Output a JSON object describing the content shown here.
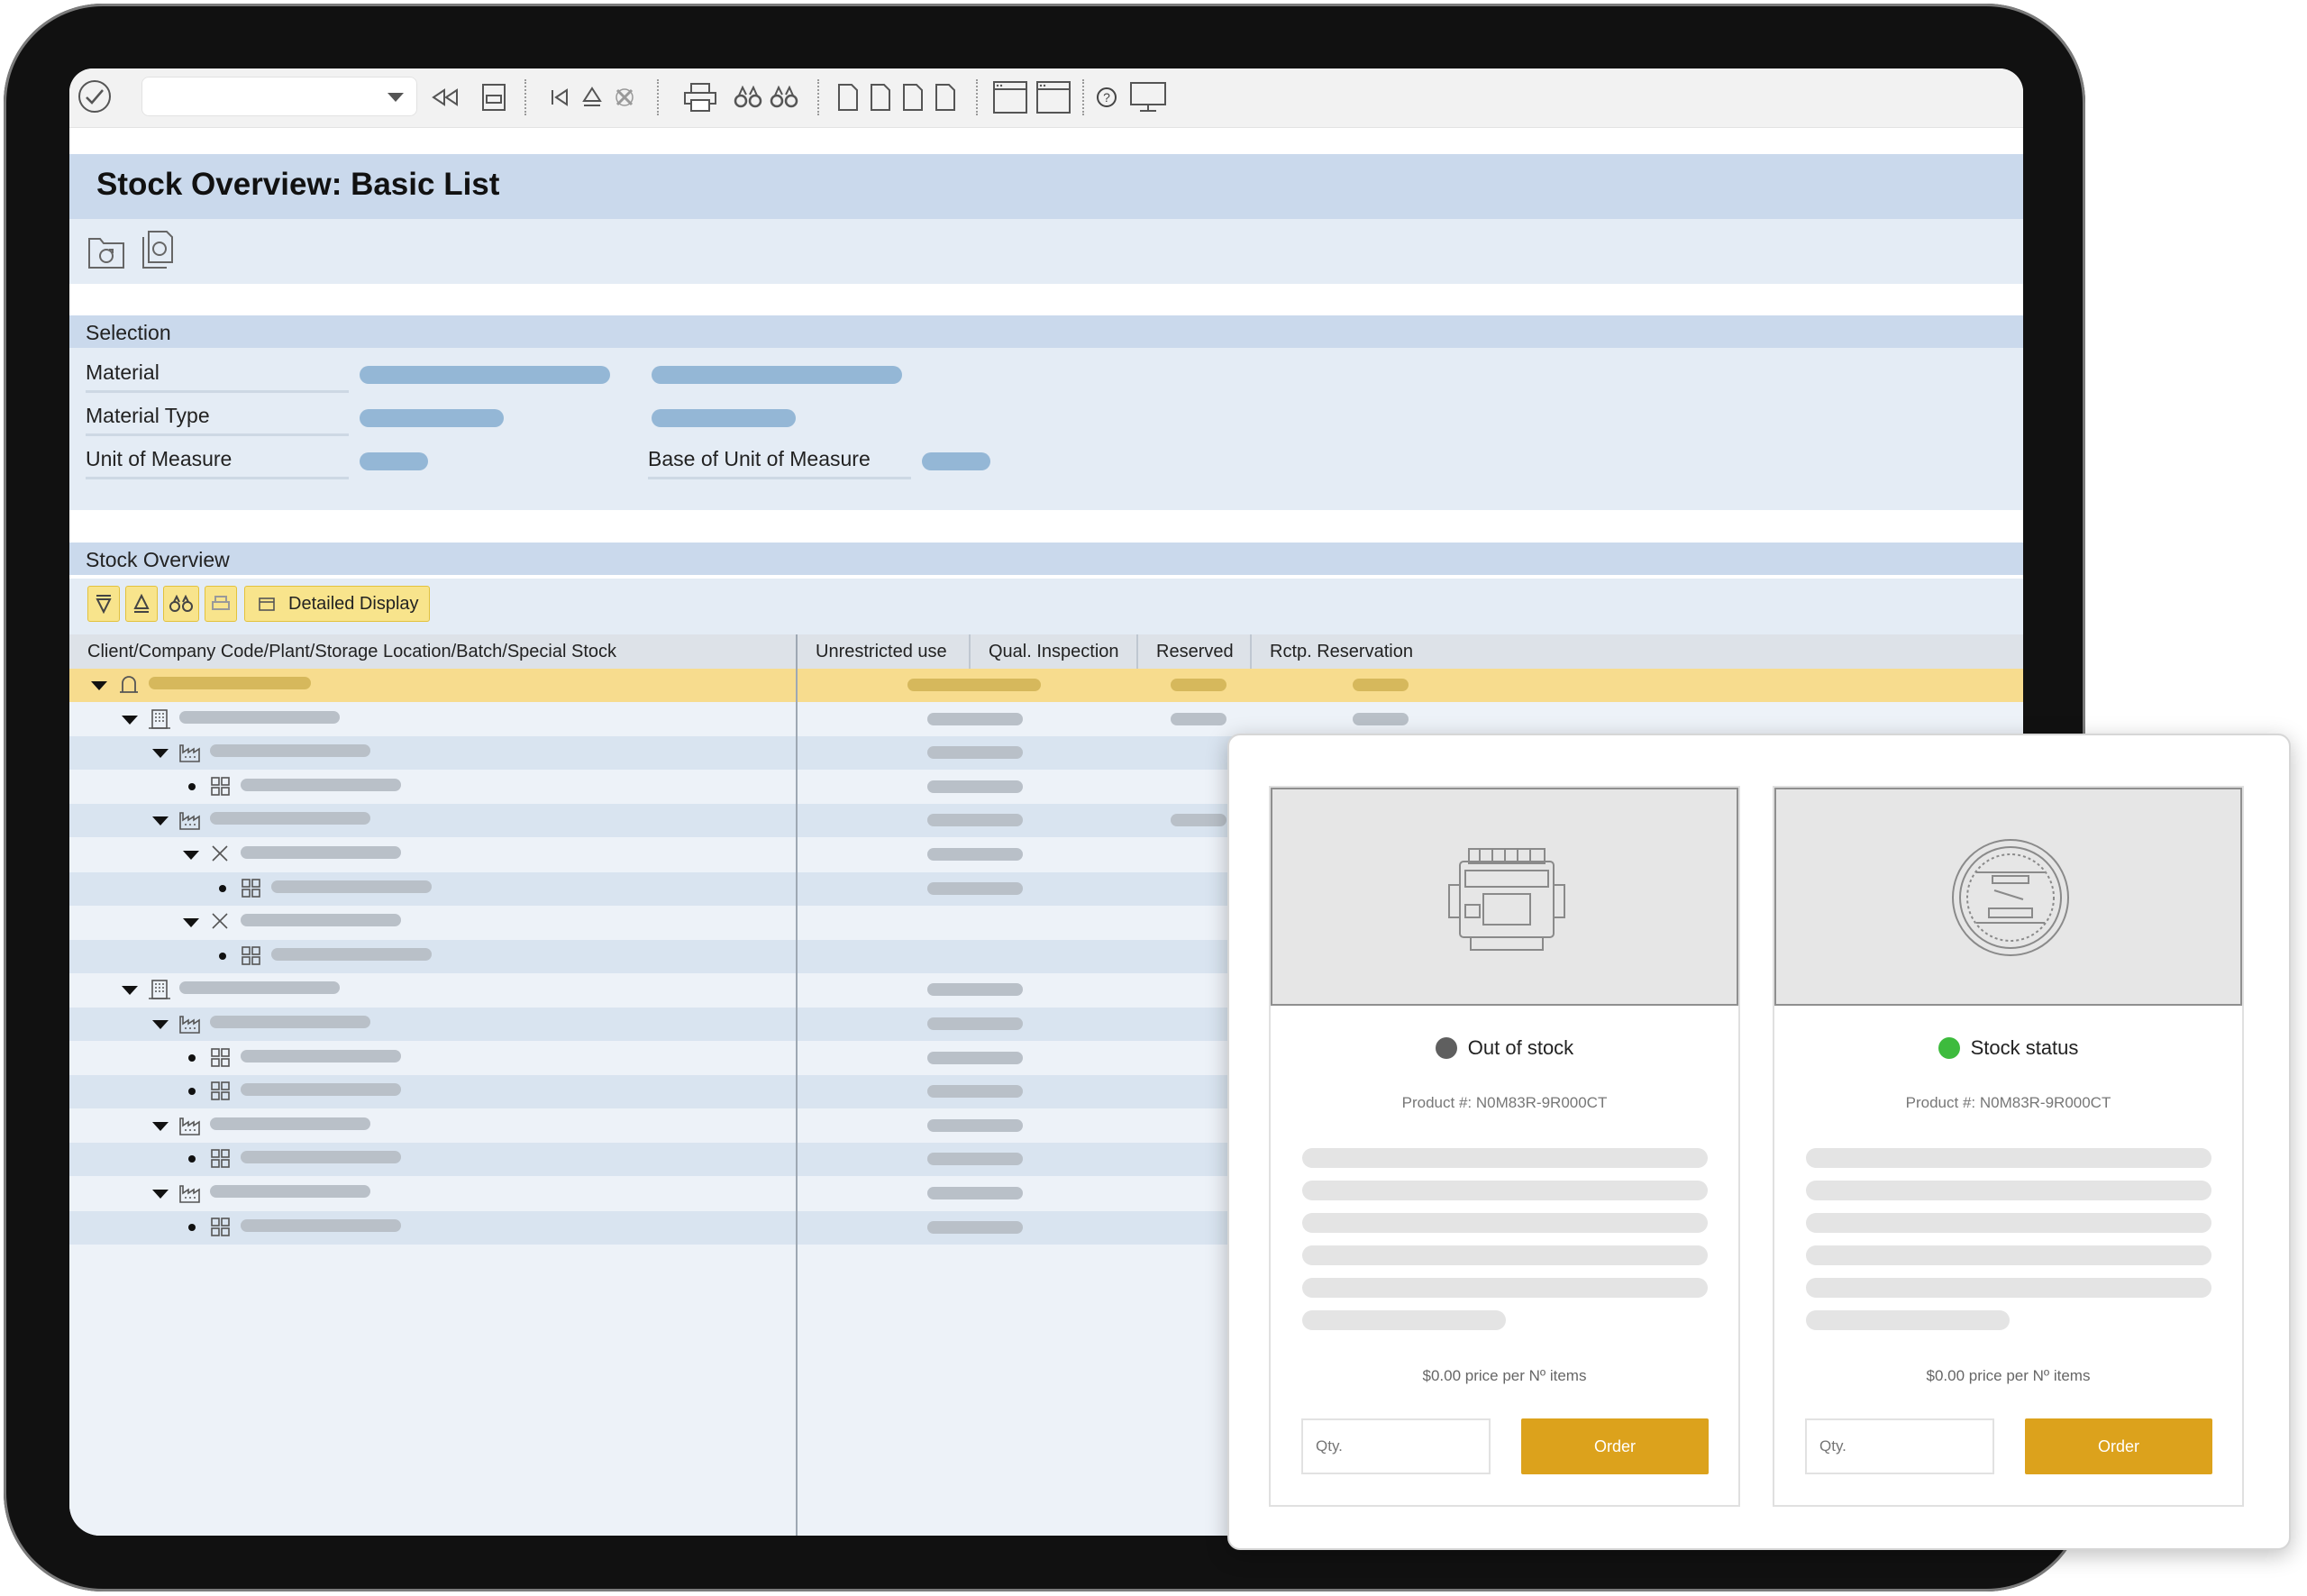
{
  "page_title": "Stock Overview: Basic List",
  "selection": {
    "header": "Selection",
    "material_label": "Material",
    "material_type_label": "Material Type",
    "uom_label": "Unit of Measure",
    "base_uom_label": "Base of Unit of Measure"
  },
  "stock_overview": {
    "header": "Stock Overview",
    "detailed_display_label": "Detailed Display",
    "columns": [
      "Client/Company Code/Plant/Storage Location/Batch/Special Stock",
      "Unrestricted use",
      "Qual. Inspection",
      "Reserved",
      "Rctp. Reservation"
    ],
    "tree_rows": [
      {
        "level": 0,
        "node": "expanded",
        "icon": "client-bell-icon",
        "highlight": true
      },
      {
        "level": 1,
        "node": "expanded",
        "icon": "company-building-icon"
      },
      {
        "level": 2,
        "node": "expanded",
        "icon": "plant-factory-icon"
      },
      {
        "level": 3,
        "node": "leaf",
        "icon": "storage-grid-icon"
      },
      {
        "level": 2,
        "node": "expanded",
        "icon": "plant-factory-icon"
      },
      {
        "level": 3,
        "node": "expanded",
        "icon": "special-stock-cross-icon"
      },
      {
        "level": 4,
        "node": "leaf",
        "icon": "storage-grid-icon"
      },
      {
        "level": 3,
        "node": "expanded",
        "icon": "special-stock-cross-icon"
      },
      {
        "level": 4,
        "node": "leaf",
        "icon": "storage-grid-icon"
      },
      {
        "level": 1,
        "node": "expanded",
        "icon": "company-building-icon"
      },
      {
        "level": 2,
        "node": "expanded",
        "icon": "plant-factory-icon"
      },
      {
        "level": 3,
        "node": "leaf",
        "icon": "storage-grid-icon"
      },
      {
        "level": 3,
        "node": "leaf",
        "icon": "storage-grid-icon"
      },
      {
        "level": 2,
        "node": "expanded",
        "icon": "plant-factory-icon"
      },
      {
        "level": 3,
        "node": "leaf",
        "icon": "storage-grid-icon"
      },
      {
        "level": 2,
        "node": "expanded",
        "icon": "plant-factory-icon"
      },
      {
        "level": 3,
        "node": "leaf",
        "icon": "storage-grid-icon"
      }
    ]
  },
  "toolbar": {
    "icons": [
      "enter-check-icon",
      "back-icon",
      "save-icon",
      "first-page-icon",
      "up-icon",
      "cancel-icon",
      "print-icon",
      "find-icon",
      "find-next-icon",
      "page-icon",
      "page-icon",
      "page-icon",
      "page-icon",
      "new-session-icon",
      "shortcut-icon",
      "help-icon",
      "layout-icon"
    ]
  },
  "products": [
    {
      "status": "Out of stock",
      "status_color": "#5f5f5f",
      "product_number": "Product #: N0M83R-9R000CT",
      "price": "$0.00 price per Nº items",
      "qty_placeholder": "Qty.",
      "order_label": "Order",
      "image_icon": "engine-icon"
    },
    {
      "status": "Stock status",
      "status_color": "#3dbb3d",
      "product_number": "Product #: N0M83R-9R000CT",
      "price": "$0.00 price per Nº items",
      "qty_placeholder": "Qty.",
      "order_label": "Order",
      "image_icon": "gauge-meter-icon"
    }
  ],
  "colors": {
    "highlight_row": "#f7dc8e",
    "accent_order": "#dca21c",
    "section_header": "#cad9ec",
    "section_body": "#e4ecf5"
  }
}
